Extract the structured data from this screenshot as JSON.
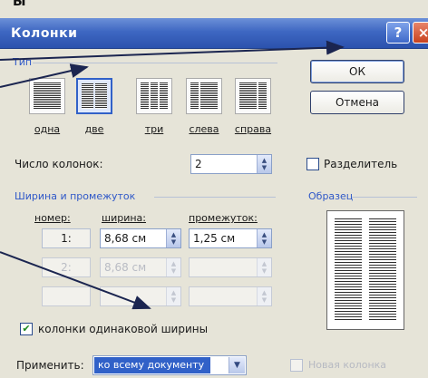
{
  "page_heading": "Ы",
  "dialog": {
    "title": "Колонки",
    "help_button": "?",
    "close_button": "×"
  },
  "type_section": {
    "label": "Тип",
    "presets": [
      {
        "label": "одна",
        "selected": false
      },
      {
        "label": "две",
        "selected": true
      },
      {
        "label": "три",
        "selected": false
      },
      {
        "label": "слева",
        "selected": false
      },
      {
        "label": "справа",
        "selected": false
      }
    ]
  },
  "buttons": {
    "ok": "ОК",
    "cancel": "Отмена"
  },
  "columns_count": {
    "label": "Число колонок:",
    "value": "2"
  },
  "separator": {
    "label": "Разделитель",
    "checked": false
  },
  "width_section": {
    "label": "Ширина и промежуток",
    "headers": {
      "number": "номер:",
      "width": "ширина:",
      "spacing": "промежуток:"
    },
    "rows": [
      {
        "number": "1:",
        "width": "8,68 см",
        "spacing": "1,25 см",
        "enabled": true
      },
      {
        "number": "2:",
        "width": "8,68 см",
        "spacing": "",
        "enabled": false
      },
      {
        "number": "",
        "width": "",
        "spacing": "",
        "enabled": false
      }
    ]
  },
  "equal_width": {
    "label": "колонки одинаковой ширины",
    "checked": true
  },
  "preview": {
    "label": "Образец"
  },
  "apply": {
    "label": "Применить:",
    "value": "ко всему документу"
  },
  "new_column": {
    "label": "Новая колонка",
    "checked": false
  },
  "colors": {
    "title_bar": "#3e67c2",
    "section_label": "#2f58c8",
    "selection": "#3161c8",
    "dialog_bg": "#e6e4d8"
  }
}
